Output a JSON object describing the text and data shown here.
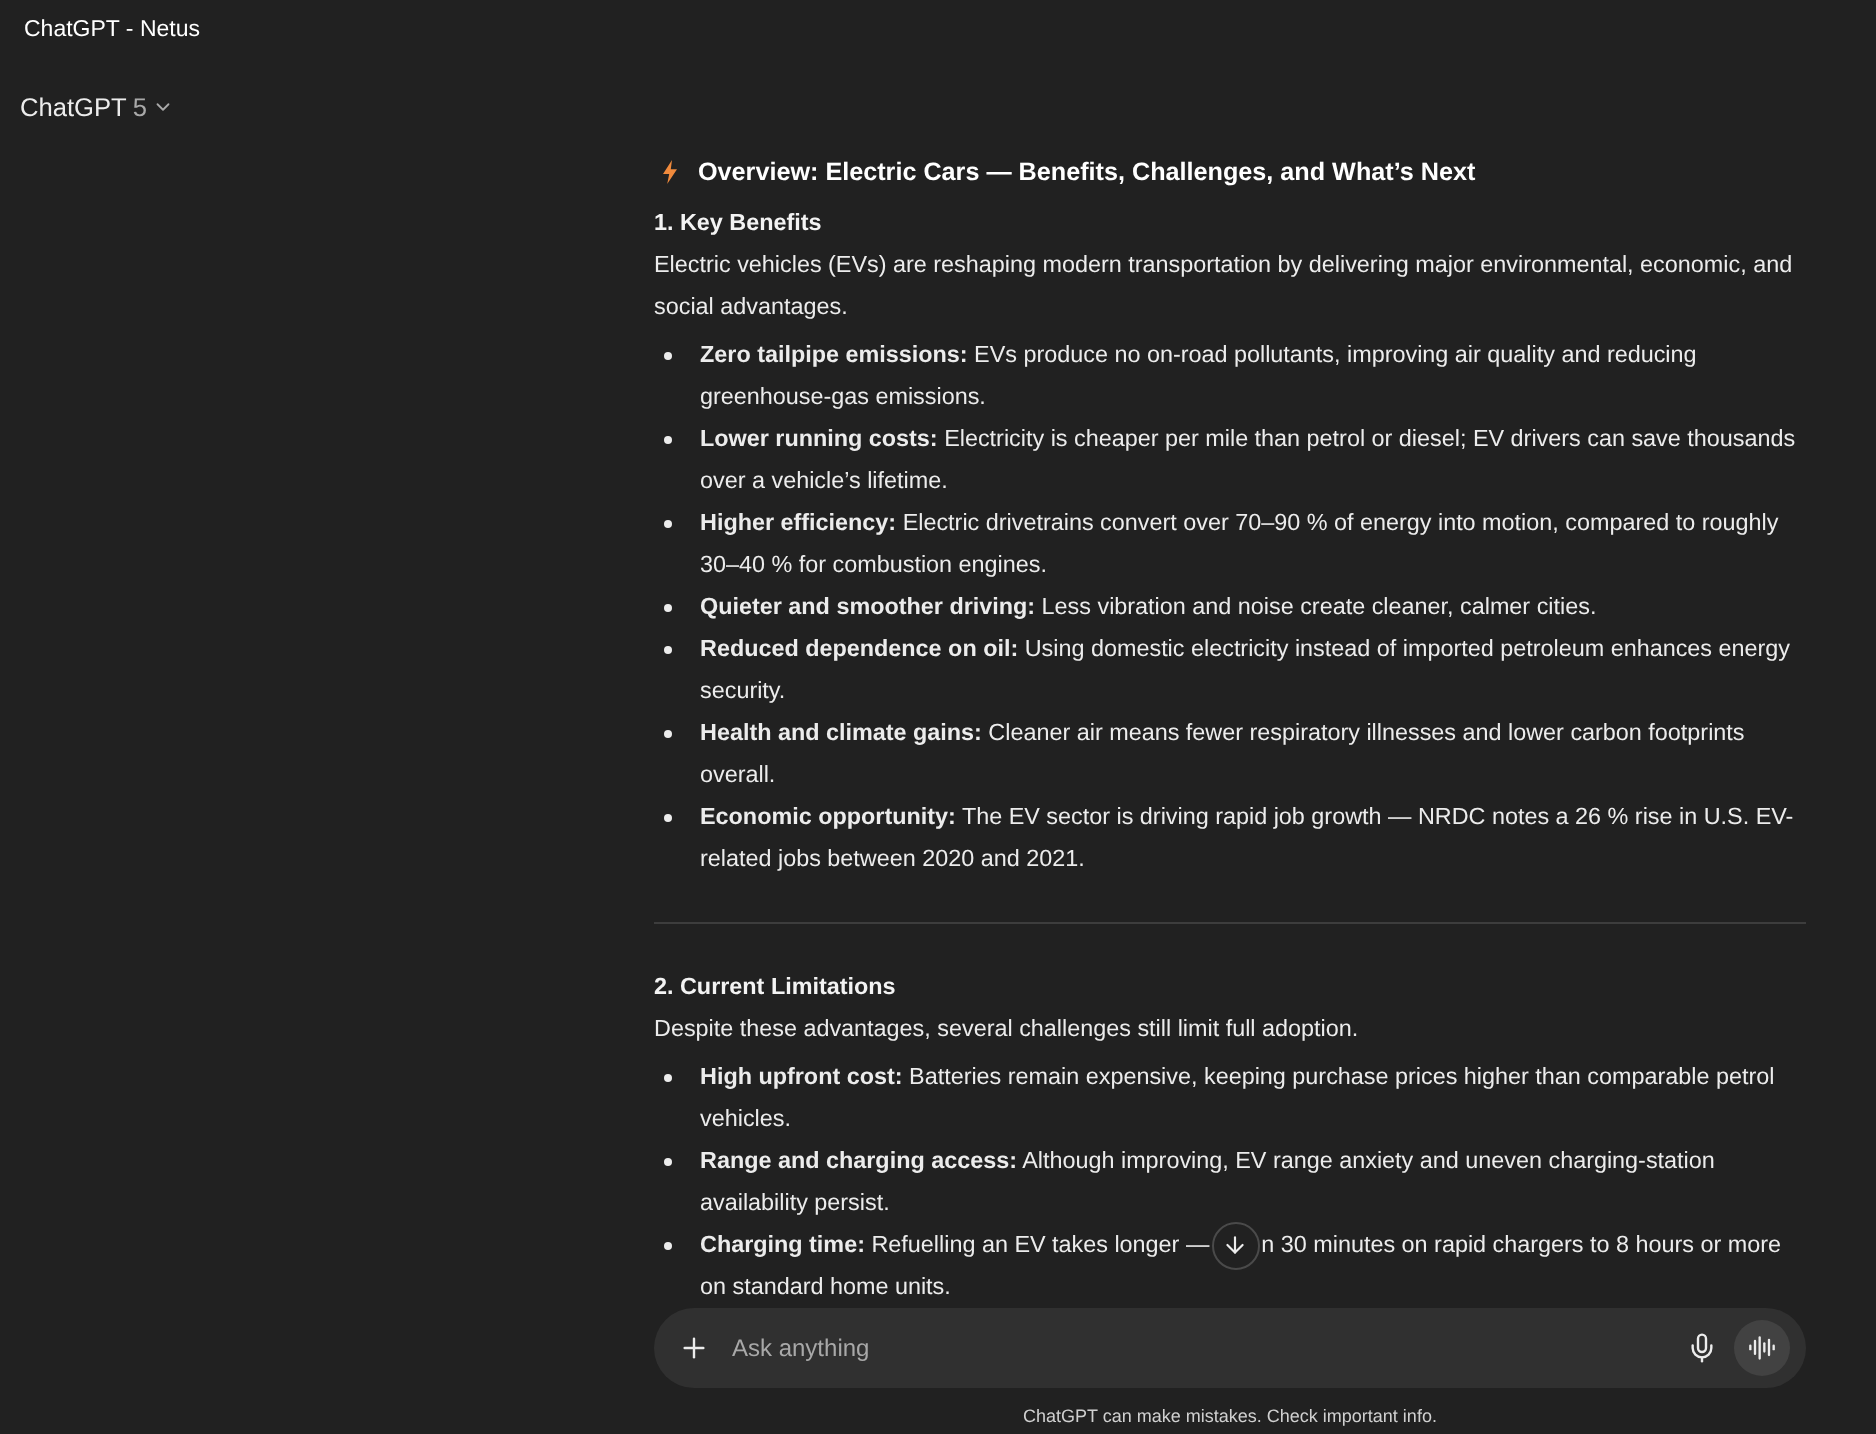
{
  "window": {
    "title": "ChatGPT - Netus"
  },
  "model_picker": {
    "name": "ChatGPT",
    "version": "5"
  },
  "response": {
    "title": "Overview: Electric Cars — Benefits, Challenges, and What’s Next",
    "sections": [
      {
        "heading": "1. Key Benefits",
        "intro": "Electric vehicles (EVs) are reshaping modern transportation by delivering major environmental, economic, and social advantages.",
        "bullets": [
          {
            "text": "**Zero tailpipe emissions:** EVs produce no on-road pollutants, improving air quality and reducing greenhouse-gas emissions."
          },
          {
            "text": "**Lower running costs:** Electricity is cheaper per mile than petrol or diesel; EV drivers can save thousands over a vehicle’s lifetime."
          },
          {
            "text": "**Higher efficiency:** Electric drivetrains convert over 70–90 % of energy into motion, compared to roughly 30–40 % for combustion engines."
          },
          {
            "text": "**Quieter and smoother driving:** Less vibration and noise create cleaner, calmer cities."
          },
          {
            "text": "**Reduced dependence on oil:** Using domestic electricity instead of imported petroleum enhances energy security."
          },
          {
            "text": "**Health and climate gains:** Cleaner air means fewer respiratory illnesses and lower carbon footprints overall."
          },
          {
            "text": "**Economic opportunity:** The EV sector is driving rapid job growth — NRDC notes a 26 % rise in U.S. EV-related jobs between 2020 and 2021."
          }
        ]
      },
      {
        "heading": "2. Current Limitations",
        "intro": "Despite these advantages, several challenges still limit full adoption.",
        "bullets": [
          {
            "text": "**High upfront cost:** Batteries remain expensive, keeping purchase prices higher than comparable petrol vehicles."
          },
          {
            "text": "**Range and charging access:** Although improving, EV range anxiety and uneven charging-station availability persist."
          },
          {
            "text": "**Charging time:** Refuelling an EV takes longer —",
            "after_button": "n 30 minutes on rapid chargers to 8 hours or more",
            "next_line": "on standard home units."
          }
        ]
      }
    ]
  },
  "composer": {
    "placeholder": "Ask anything"
  },
  "disclaimer": "ChatGPT can make mistakes. Check important info."
}
